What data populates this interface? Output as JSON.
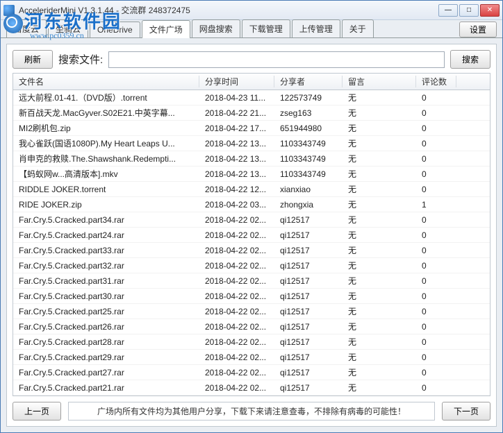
{
  "window": {
    "title": "AcceleriderMini V1.3.1.44 - 交流群 248372475"
  },
  "tabs": [
    {
      "label": "百度云"
    },
    {
      "label": "坐骑云"
    },
    {
      "label": "OneDrive"
    },
    {
      "label": "文件广场"
    },
    {
      "label": "网盘搜索"
    },
    {
      "label": "下载管理"
    },
    {
      "label": "上传管理"
    },
    {
      "label": "关于"
    }
  ],
  "settings_btn": "设置",
  "refresh_btn": "刷新",
  "search_label": "搜索文件:",
  "search_btn": "搜索",
  "columns": [
    "文件名",
    "分享时间",
    "分享者",
    "留言",
    "评论数"
  ],
  "rows": [
    {
      "name": "远大前程.01-41.（DVD版）.torrent",
      "time": "2018-04-23 11...",
      "sharer": "122573749",
      "msg": "无",
      "cnt": "0"
    },
    {
      "name": "新百战天龙.MacGyver.S02E21.中英字幕...",
      "time": "2018-04-22 21...",
      "sharer": "zseg163",
      "msg": "无",
      "cnt": "0"
    },
    {
      "name": "MI2刷机包.zip",
      "time": "2018-04-22 17...",
      "sharer": "651944980",
      "msg": "无",
      "cnt": "0"
    },
    {
      "name": "我心雀跃(国语1080P).My Heart Leaps U...",
      "time": "2018-04-22 13...",
      "sharer": "1103343749",
      "msg": "无",
      "cnt": "0"
    },
    {
      "name": "肖申克的救赎.The.Shawshank.Redempti...",
      "time": "2018-04-22 13...",
      "sharer": "1103343749",
      "msg": "无",
      "cnt": "0"
    },
    {
      "name": "【蚂蚁网w...高清版本].mkv",
      "time": "2018-04-22 13...",
      "sharer": "1103343749",
      "msg": "无",
      "cnt": "0"
    },
    {
      "name": "RIDDLE JOKER.torrent",
      "time": "2018-04-22 12...",
      "sharer": "xianxiao",
      "msg": "无",
      "cnt": "0"
    },
    {
      "name": "RIDE JOKER.zip",
      "time": "2018-04-22 03...",
      "sharer": "zhongxia",
      "msg": "无",
      "cnt": "1"
    },
    {
      "name": "Far.Cry.5.Cracked.part34.rar",
      "time": "2018-04-22 02...",
      "sharer": "qi12517",
      "msg": "无",
      "cnt": "0"
    },
    {
      "name": "Far.Cry.5.Cracked.part24.rar",
      "time": "2018-04-22 02...",
      "sharer": "qi12517",
      "msg": "无",
      "cnt": "0"
    },
    {
      "name": "Far.Cry.5.Cracked.part33.rar",
      "time": "2018-04-22 02...",
      "sharer": "qi12517",
      "msg": "无",
      "cnt": "0"
    },
    {
      "name": "Far.Cry.5.Cracked.part32.rar",
      "time": "2018-04-22 02...",
      "sharer": "qi12517",
      "msg": "无",
      "cnt": "0"
    },
    {
      "name": "Far.Cry.5.Cracked.part31.rar",
      "time": "2018-04-22 02...",
      "sharer": "qi12517",
      "msg": "无",
      "cnt": "0"
    },
    {
      "name": "Far.Cry.5.Cracked.part30.rar",
      "time": "2018-04-22 02...",
      "sharer": "qi12517",
      "msg": "无",
      "cnt": "0"
    },
    {
      "name": "Far.Cry.5.Cracked.part25.rar",
      "time": "2018-04-22 02...",
      "sharer": "qi12517",
      "msg": "无",
      "cnt": "0"
    },
    {
      "name": "Far.Cry.5.Cracked.part26.rar",
      "time": "2018-04-22 02...",
      "sharer": "qi12517",
      "msg": "无",
      "cnt": "0"
    },
    {
      "name": "Far.Cry.5.Cracked.part28.rar",
      "time": "2018-04-22 02...",
      "sharer": "qi12517",
      "msg": "无",
      "cnt": "0"
    },
    {
      "name": "Far.Cry.5.Cracked.part29.rar",
      "time": "2018-04-22 02...",
      "sharer": "qi12517",
      "msg": "无",
      "cnt": "0"
    },
    {
      "name": "Far.Cry.5.Cracked.part27.rar",
      "time": "2018-04-22 02...",
      "sharer": "qi12517",
      "msg": "无",
      "cnt": "0"
    },
    {
      "name": "Far.Cry.5.Cracked.part21.rar",
      "time": "2018-04-22 02...",
      "sharer": "qi12517",
      "msg": "无",
      "cnt": "0"
    }
  ],
  "prev_btn": "上一页",
  "next_btn": "下一页",
  "notice": "广场内所有文件均为其他用户分享，下载下来请注意查毒，不排除有病毒的可能性！",
  "watermark": {
    "line1": "河东软件园",
    "line2": "www.pc0359.cn"
  }
}
